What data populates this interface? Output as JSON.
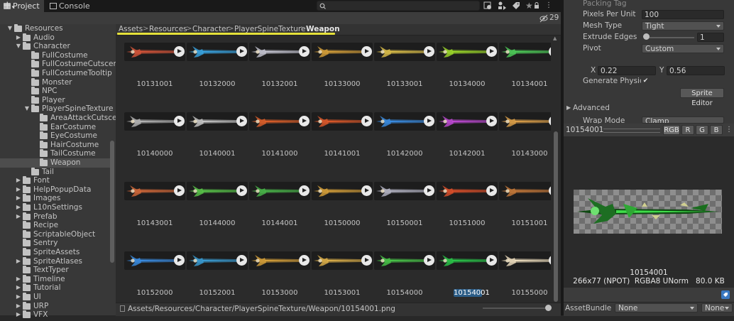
{
  "tabs": [
    {
      "label": "Project",
      "icon": "folder-icon",
      "active": true
    },
    {
      "label": "Console",
      "icon": "console-icon",
      "active": false
    }
  ],
  "toolbar": {
    "add_label": "+",
    "hidden_count": "29"
  },
  "tree": {
    "items": [
      {
        "label": "Resources",
        "depth": 1,
        "expanded": true,
        "arrow": true
      },
      {
        "label": "Audio",
        "depth": 2,
        "arrow": true
      },
      {
        "label": "Character",
        "depth": 2,
        "expanded": true,
        "arrow": true
      },
      {
        "label": "FullCostume",
        "depth": 3
      },
      {
        "label": "FullCostumeCutscen",
        "depth": 3
      },
      {
        "label": "FullCostumeTooltip",
        "depth": 3
      },
      {
        "label": "Monster",
        "depth": 3
      },
      {
        "label": "NPC",
        "depth": 3
      },
      {
        "label": "Player",
        "depth": 3
      },
      {
        "label": "PlayerSpineTexture",
        "depth": 3,
        "expanded": true,
        "arrow": true
      },
      {
        "label": "AreaAttackCutsce",
        "depth": 4
      },
      {
        "label": "EarCostume",
        "depth": 4
      },
      {
        "label": "EyeCostume",
        "depth": 4
      },
      {
        "label": "HairCostume",
        "depth": 4
      },
      {
        "label": "TailCostume",
        "depth": 4
      },
      {
        "label": "Weapon",
        "depth": 4,
        "selected": true
      },
      {
        "label": "Tail",
        "depth": 3
      },
      {
        "label": "Font",
        "depth": 2,
        "arrow": true
      },
      {
        "label": "HelpPopupData",
        "depth": 2,
        "arrow": true
      },
      {
        "label": "Images",
        "depth": 2,
        "arrow": true
      },
      {
        "label": "L10nSettings",
        "depth": 2,
        "arrow": true
      },
      {
        "label": "Prefab",
        "depth": 2,
        "arrow": true
      },
      {
        "label": "Recipe",
        "depth": 2
      },
      {
        "label": "ScriptableObject",
        "depth": 2
      },
      {
        "label": "Sentry",
        "depth": 2
      },
      {
        "label": "SpriteAssets",
        "depth": 2
      },
      {
        "label": "SpriteAtlases",
        "depth": 2,
        "arrow": true
      },
      {
        "label": "TextTyper",
        "depth": 2
      },
      {
        "label": "Timeline",
        "depth": 2,
        "arrow": true
      },
      {
        "label": "Tutorial",
        "depth": 2,
        "arrow": true
      },
      {
        "label": "UI",
        "depth": 2,
        "arrow": true
      },
      {
        "label": "URP",
        "depth": 2,
        "arrow": true
      },
      {
        "label": "VFX",
        "depth": 2,
        "arrow": true
      }
    ]
  },
  "breadcrumb": [
    "Assets",
    "Resources",
    "Character",
    "PlayerSpineTexture",
    "Weapon"
  ],
  "assets": [
    {
      "name": "10131001",
      "color": "#d9563a"
    },
    {
      "name": "10132000",
      "color": "#3aa7e6"
    },
    {
      "name": "10132001",
      "color": "#c9c9d6"
    },
    {
      "name": "10133000",
      "color": "#d9a23a"
    },
    {
      "name": "10133001",
      "color": "#e0c24a"
    },
    {
      "name": "10134000",
      "color": "#9fdc2a"
    },
    {
      "name": "10134001",
      "color": "#4fcf5a"
    },
    {
      "name": "10140000",
      "color": "#b8b8b8"
    },
    {
      "name": "10140001",
      "color": "#c9c9c9"
    },
    {
      "name": "10141000",
      "color": "#e0602a"
    },
    {
      "name": "10141001",
      "color": "#e05a2a"
    },
    {
      "name": "10142000",
      "color": "#3a8ee6"
    },
    {
      "name": "10142001",
      "color": "#c04ad6"
    },
    {
      "name": "10143000",
      "color": "#e0a24a"
    },
    {
      "name": "10143001",
      "color": "#d66a3a"
    },
    {
      "name": "10144000",
      "color": "#5ac84a"
    },
    {
      "name": "10144001",
      "color": "#4ab84a"
    },
    {
      "name": "10150000",
      "color": "#d9a23a"
    },
    {
      "name": "10150001",
      "color": "#b8b8c8"
    },
    {
      "name": "10151000",
      "color": "#e0502a"
    },
    {
      "name": "10151001",
      "color": "#c87a3a"
    },
    {
      "name": "10152000",
      "color": "#3a8ee6"
    },
    {
      "name": "10152001",
      "color": "#3a9ed6"
    },
    {
      "name": "10153000",
      "color": "#d9a23a"
    },
    {
      "name": "10153001",
      "color": "#e0b24a"
    },
    {
      "name": "10154000",
      "color": "#4ac84a"
    },
    {
      "name": "10154001",
      "color": "#2ac84a",
      "selected": true
    },
    {
      "name": "10155000",
      "color": "#f0e0c0"
    }
  ],
  "status_path": "Assets/Resources/Character/PlayerSpineTexture/Weapon/10154001.png",
  "inspector": {
    "packing_tag_label": "Packing Tag",
    "pixels_per_unit_label": "Pixels Per Unit",
    "pixels_per_unit": "100",
    "mesh_type_label": "Mesh Type",
    "mesh_type": "Tight",
    "extrude_edges_label": "Extrude Edges",
    "extrude_edges": "1",
    "pivot_label": "Pivot",
    "pivot": "Custom",
    "x_label": "X",
    "x_value": "0.22",
    "y_label": "Y",
    "y_value": "0.56",
    "generate_physics_label": "Generate Physics S",
    "sprite_editor_label": "Sprite Editor",
    "advanced_label": "Advanced",
    "wrap_mode_label": "Wrap Mode",
    "wrap_mode": "Clamp"
  },
  "preview": {
    "name": "10154001",
    "channels": [
      "RGB",
      "R",
      "G",
      "B"
    ],
    "title": "10154001",
    "info": "266x77 (NPOT)  RGBA8 UNorm   80.0 KB"
  },
  "asset_bundle": {
    "label": "AssetBundle",
    "value": "None",
    "variant": "None"
  }
}
